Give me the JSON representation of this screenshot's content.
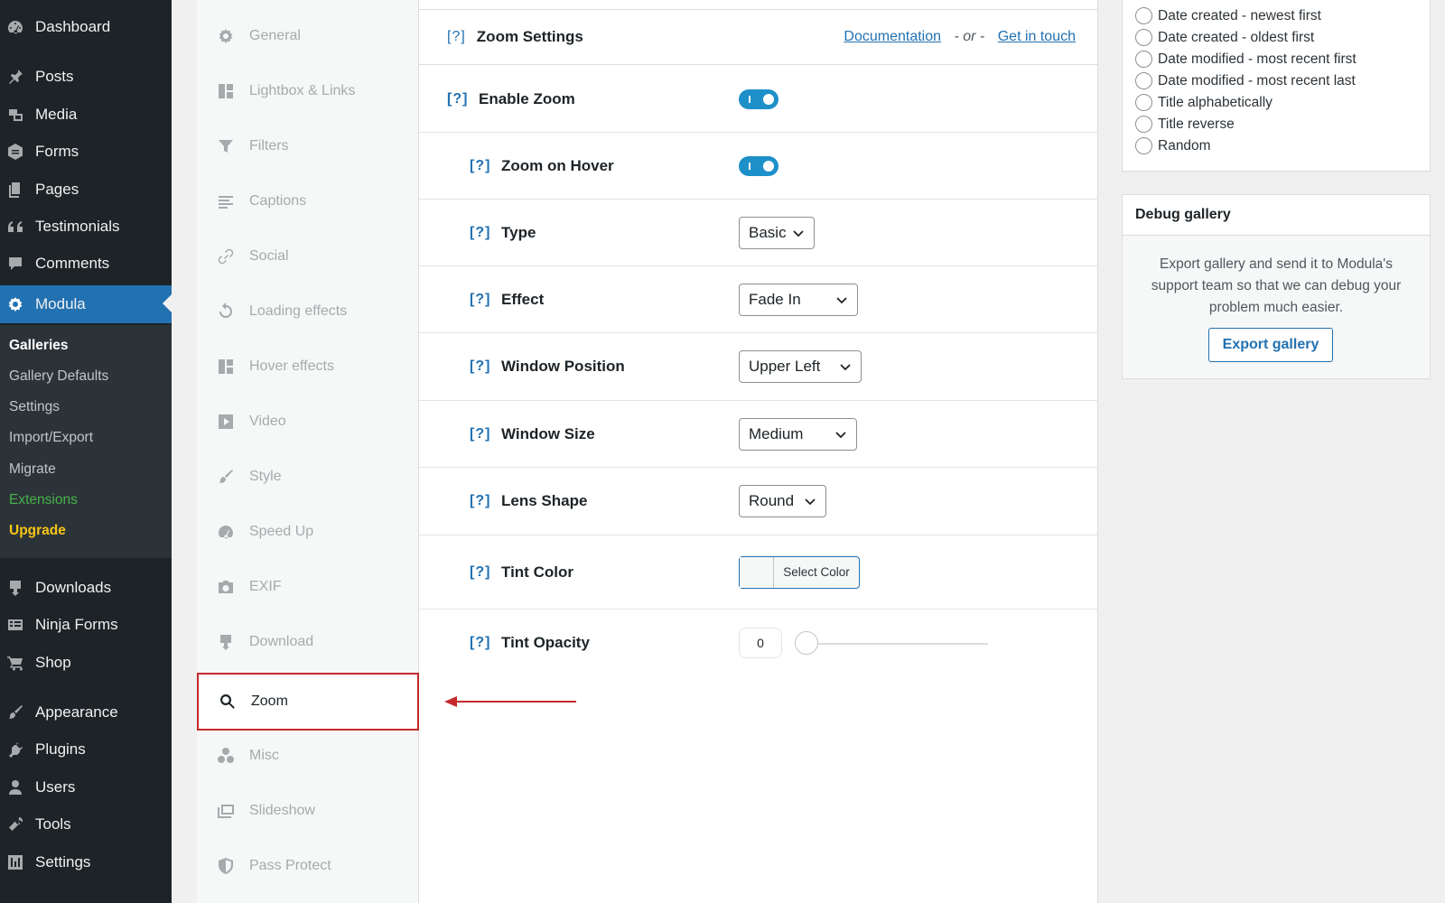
{
  "admin_menu": {
    "items": [
      {
        "label": "Dashboard",
        "icon": "dashboard-icon"
      },
      {
        "label": "Posts",
        "icon": "pushpin-icon"
      },
      {
        "label": "Media",
        "icon": "media-icon"
      },
      {
        "label": "Forms",
        "icon": "forms-icon"
      },
      {
        "label": "Pages",
        "icon": "pages-icon"
      },
      {
        "label": "Testimonials",
        "icon": "quote-icon"
      },
      {
        "label": "Comments",
        "icon": "comment-icon"
      },
      {
        "label": "Modula",
        "icon": "gear-icon"
      },
      {
        "label": "Downloads",
        "icon": "download-icon"
      },
      {
        "label": "Ninja Forms",
        "icon": "forms-list-icon"
      },
      {
        "label": "Shop",
        "icon": "cart-icon"
      },
      {
        "label": "Appearance",
        "icon": "brush-icon"
      },
      {
        "label": "Plugins",
        "icon": "plugin-icon"
      },
      {
        "label": "Users",
        "icon": "user-icon"
      },
      {
        "label": "Tools",
        "icon": "wrench-icon"
      },
      {
        "label": "Settings",
        "icon": "settings-icon"
      }
    ],
    "submenu": [
      "Galleries",
      "Gallery Defaults",
      "Settings",
      "Import/Export",
      "Migrate",
      "Extensions",
      "Upgrade"
    ]
  },
  "tabs": [
    {
      "label": "General",
      "icon": "gear-icon"
    },
    {
      "label": "Lightbox & Links",
      "icon": "grid-icon"
    },
    {
      "label": "Filters",
      "icon": "funnel-icon"
    },
    {
      "label": "Captions",
      "icon": "lines-icon"
    },
    {
      "label": "Social",
      "icon": "link-icon"
    },
    {
      "label": "Loading effects",
      "icon": "refresh-icon"
    },
    {
      "label": "Hover effects",
      "icon": "grid-icon"
    },
    {
      "label": "Video",
      "icon": "play-icon"
    },
    {
      "label": "Style",
      "icon": "brush-icon"
    },
    {
      "label": "Speed Up",
      "icon": "speedometer-icon"
    },
    {
      "label": "EXIF",
      "icon": "camera-icon"
    },
    {
      "label": "Download",
      "icon": "download-icon"
    },
    {
      "label": "Zoom",
      "icon": "search-icon"
    },
    {
      "label": "Misc",
      "icon": "circles-icon"
    },
    {
      "label": "Slideshow",
      "icon": "images-icon"
    },
    {
      "label": "Pass Protect",
      "icon": "shield-icon"
    }
  ],
  "header": {
    "help": "[?]",
    "title": "Zoom Settings",
    "doc_link": "Documentation",
    "or_text": "- or -",
    "contact_link": "Get in touch"
  },
  "settings": {
    "enable_zoom": {
      "help": "[?]",
      "label": "Enable Zoom",
      "on": true
    },
    "zoom_on_hover": {
      "help": "[?]",
      "label": "Zoom on Hover",
      "on": true
    },
    "type": {
      "help": "[?]",
      "label": "Type",
      "value": "Basic"
    },
    "effect": {
      "help": "[?]",
      "label": "Effect",
      "value": "Fade In"
    },
    "window_position": {
      "help": "[?]",
      "label": "Window Position",
      "value": "Upper Left"
    },
    "window_size": {
      "help": "[?]",
      "label": "Window Size",
      "value": "Medium"
    },
    "lens_shape": {
      "help": "[?]",
      "label": "Lens Shape",
      "value": "Round"
    },
    "tint_color": {
      "help": "[?]",
      "label": "Tint Color",
      "button": "Select Color"
    },
    "tint_opacity": {
      "help": "[?]",
      "label": "Tint Opacity",
      "value": "0"
    }
  },
  "sort_order": {
    "options": [
      "Date created - newest first",
      "Date created - oldest first",
      "Date modified - most recent first",
      "Date modified - most recent last",
      "Title alphabetically",
      "Title reverse",
      "Random"
    ]
  },
  "debug": {
    "title": "Debug gallery",
    "text": "Export gallery and send it to Modula's support team so that we can debug your problem much easier.",
    "button": "Export gallery"
  },
  "colors": {
    "admin_bg": "#1d2327",
    "active_blue": "#2271b1",
    "toggle_on": "#1e90c9",
    "highlight_red": "#c5292b",
    "extensions_green": "#48b14b",
    "upgrade_yellow": "#f5c518"
  }
}
